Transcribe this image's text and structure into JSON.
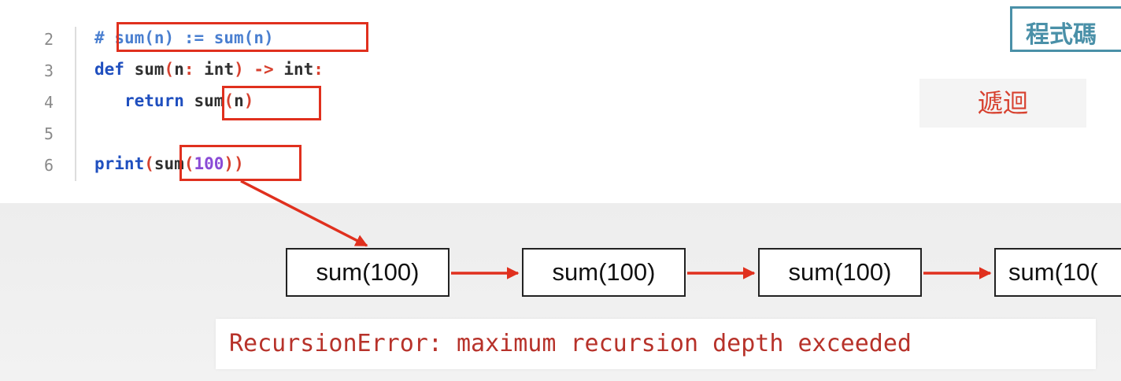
{
  "badges": {
    "code": "程式碼",
    "recursion": "遞迴"
  },
  "code": {
    "lines": [
      {
        "no": "2",
        "parts": [
          "#",
          "sum(n) := sum(n)"
        ]
      },
      {
        "no": "3",
        "parts": [
          "def",
          "sum",
          "(",
          "n",
          ":",
          "int",
          ")",
          "->",
          "int",
          ":"
        ]
      },
      {
        "no": "4",
        "parts": [
          "return",
          "sum",
          "(",
          "n",
          ")"
        ]
      },
      {
        "no": "5",
        "parts": []
      },
      {
        "no": "6",
        "parts": [
          "print",
          "(",
          "sum",
          "(",
          "100",
          ")",
          ")"
        ]
      }
    ]
  },
  "diagram": {
    "calls": [
      "sum(100)",
      "sum(100)",
      "sum(100)",
      "sum(10("
    ]
  },
  "error": {
    "message": "RecursionError: maximum recursion depth exceeded"
  },
  "colors": {
    "highlight": "#e0301e",
    "keyword": "#1f4fbf",
    "comment": "#4a7fd0",
    "number": "#8a4bd6",
    "error": "#b7322a",
    "badge": "#4a90a8"
  }
}
